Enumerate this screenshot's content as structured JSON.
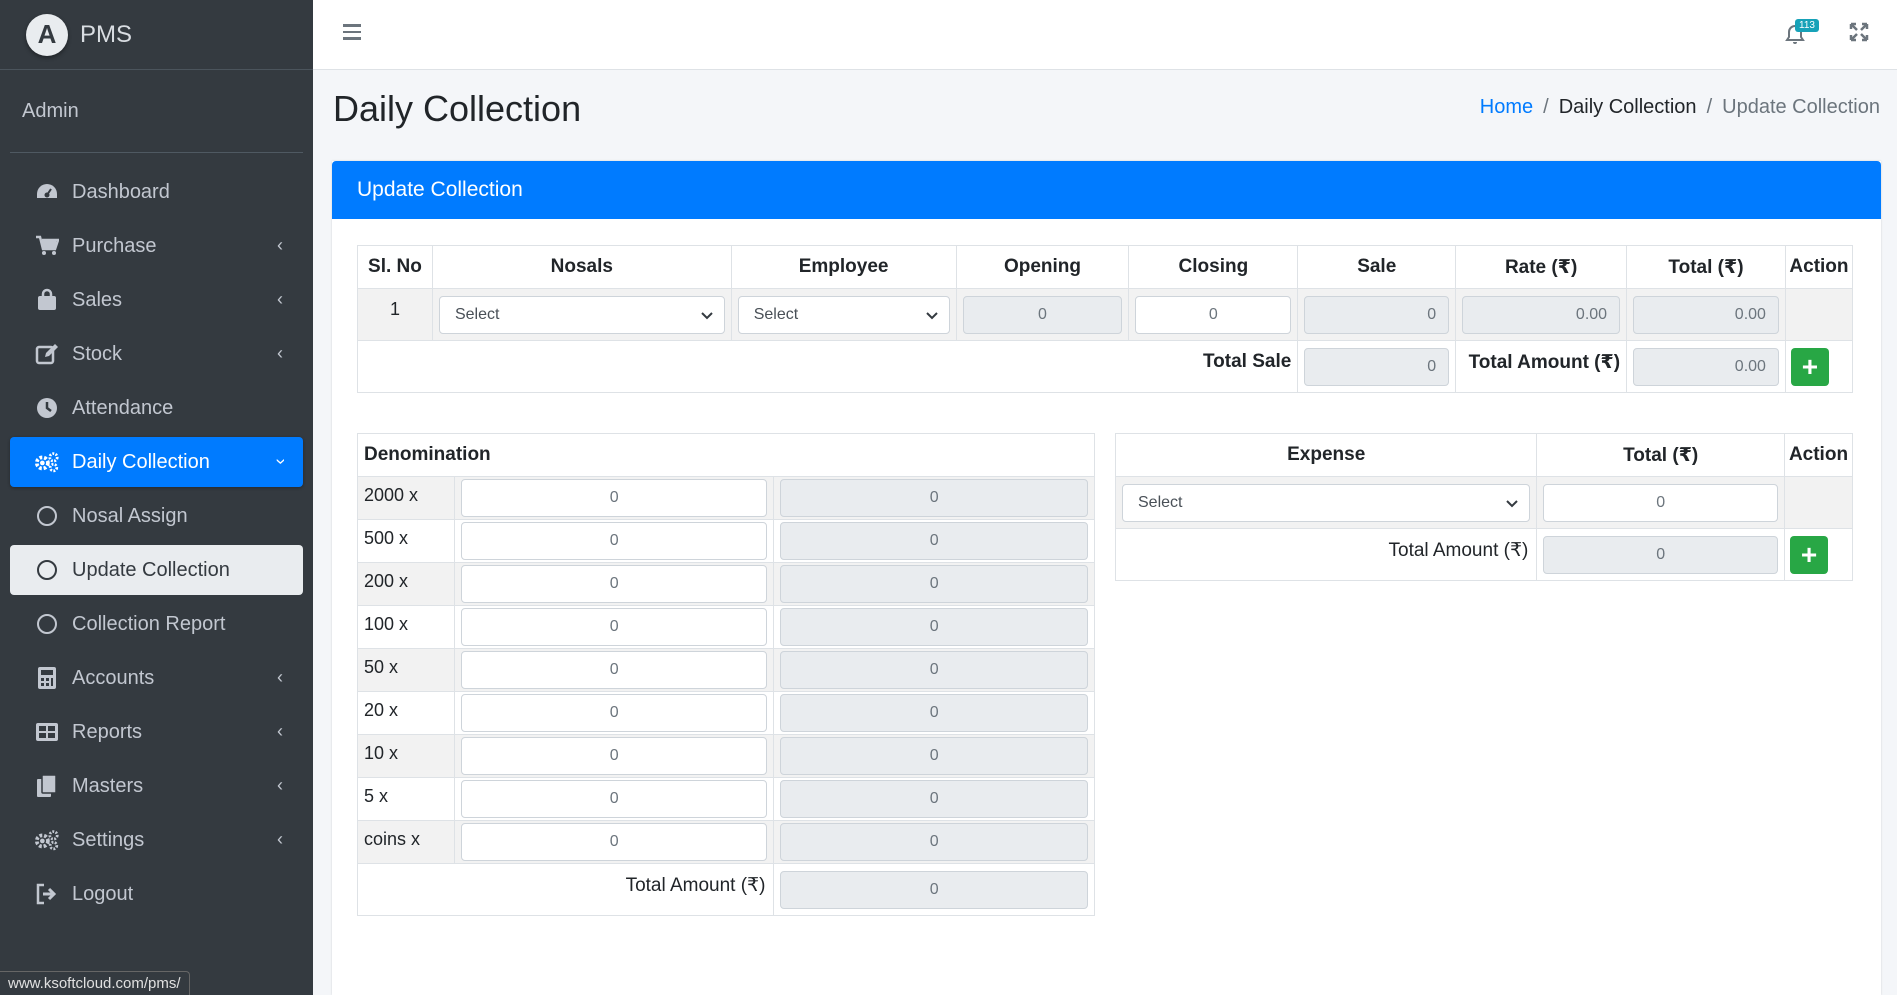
{
  "brand": {
    "name": "PMS",
    "logo_letter": "A"
  },
  "user": {
    "name": "Admin"
  },
  "sidebar": {
    "items": [
      {
        "label": "Dashboard",
        "icon": "dashboard-icon"
      },
      {
        "label": "Purchase",
        "icon": "cart-icon"
      },
      {
        "label": "Sales",
        "icon": "shopping-bag-icon"
      },
      {
        "label": "Stock",
        "icon": "edit-icon"
      },
      {
        "label": "Attendance",
        "icon": "clock-icon"
      },
      {
        "label": "Daily Collection",
        "icon": "cogs-icon"
      },
      {
        "label": "Nosal Assign",
        "icon": "circle-icon"
      },
      {
        "label": "Update Collection",
        "icon": "circle-icon"
      },
      {
        "label": "Collection Report",
        "icon": "circle-icon"
      },
      {
        "label": "Accounts",
        "icon": "calculator-icon"
      },
      {
        "label": "Reports",
        "icon": "table-icon"
      },
      {
        "label": "Masters",
        "icon": "copy-icon"
      },
      {
        "label": "Settings",
        "icon": "cogs-icon"
      },
      {
        "label": "Logout",
        "icon": "sign-out-icon"
      }
    ]
  },
  "topbar": {
    "notification_count": "113"
  },
  "status_url": "www.ksoftcloud.com/pms/",
  "page": {
    "title": "Daily Collection",
    "breadcrumb": {
      "home": "Home",
      "section": "Daily Collection",
      "current": "Update Collection"
    }
  },
  "card": {
    "title": "Update Collection"
  },
  "main_table": {
    "headers": [
      "Sl. No",
      "Nosals",
      "Employee",
      "Opening",
      "Closing",
      "Sale",
      "Rate (₹)",
      "Total (₹)",
      "Action"
    ],
    "row": {
      "sl": "1",
      "nosal": "Select",
      "employee": "Select",
      "opening": "0",
      "closing": "0",
      "sale": "0",
      "rate": "0.00",
      "total": "0.00"
    },
    "total_sale_label": "Total Sale",
    "total_sale": "0",
    "total_amount_label": "Total Amount (₹)",
    "total_amount": "0.00"
  },
  "denomination": {
    "header": "Denomination",
    "rows": [
      {
        "label": "2000 x",
        "count": "0",
        "amount": "0"
      },
      {
        "label": "500 x",
        "count": "0",
        "amount": "0"
      },
      {
        "label": "200 x",
        "count": "0",
        "amount": "0"
      },
      {
        "label": "100 x",
        "count": "0",
        "amount": "0"
      },
      {
        "label": "50 x",
        "count": "0",
        "amount": "0"
      },
      {
        "label": "20 x",
        "count": "0",
        "amount": "0"
      },
      {
        "label": "10 x",
        "count": "0",
        "amount": "0"
      },
      {
        "label": "5 x",
        "count": "0",
        "amount": "0"
      },
      {
        "label": "coins x",
        "count": "0",
        "amount": "0"
      }
    ],
    "total_label": "Total Amount (₹)",
    "total": "0"
  },
  "expense": {
    "headers": [
      "Expense",
      "Total (₹)",
      "Action"
    ],
    "select": "Select",
    "amount": "0",
    "total_label": "Total Amount (₹)",
    "total": "0"
  },
  "colors": {
    "primary": "#007bff",
    "sidebar": "#343a40",
    "success": "#28a745"
  }
}
